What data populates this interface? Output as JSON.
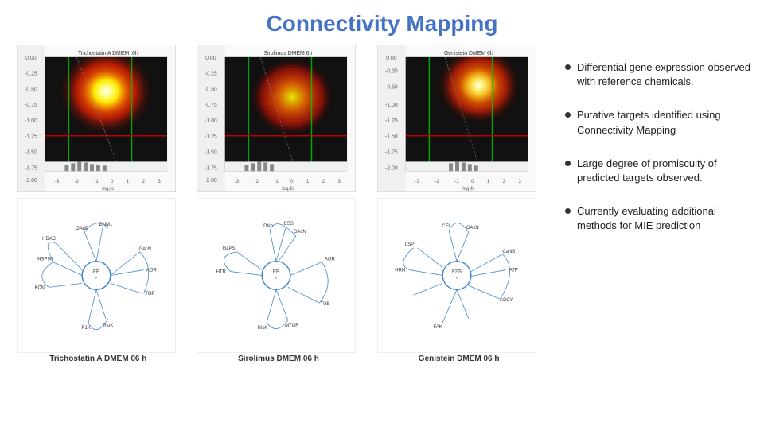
{
  "title": "Connectivity Mapping",
  "bullets": [
    {
      "id": "bullet-1",
      "text": "Differential gene expression observed with reference chemicals."
    },
    {
      "id": "bullet-2",
      "text": "Putative targets identified using Connectivity Mapping"
    },
    {
      "id": "bullet-3",
      "text": "Large degree of promiscuity of predicted targets observed."
    },
    {
      "id": "bullet-4",
      "text": "Currently evaluating additional methods for MIE prediction"
    }
  ],
  "scatter_charts": [
    {
      "label": "Trichostatin A DMEM 06 h",
      "title": "Trichostatin A DMEM :6h"
    },
    {
      "label": "Sirolimus DMEM 06 h",
      "title": "Sirolimus DMEM 6h"
    },
    {
      "label": "Genistein DMEM 06 h",
      "title": "Genistein DMEM 6h"
    }
  ]
}
